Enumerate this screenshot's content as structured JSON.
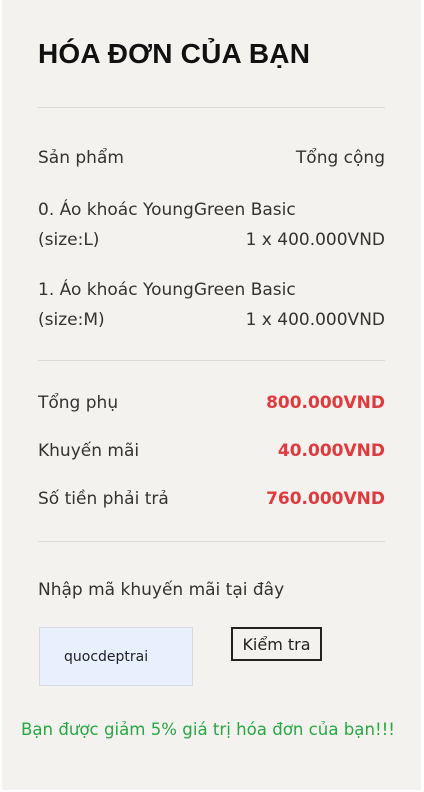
{
  "invoice": {
    "title": "HÓA ĐƠN CỦA BẠN",
    "header": {
      "product_label": "Sản phẩm",
      "total_label": "Tổng cộng"
    },
    "items": [
      {
        "name": "0. Áo khoác YoungGreen Basic",
        "size": "(size:L)",
        "qty_price": "1 x 400.000VND"
      },
      {
        "name": "1. Áo khoác YoungGreen Basic",
        "size": "(size:M)",
        "qty_price": "1 x 400.000VND"
      }
    ],
    "summary": {
      "subtotal_label": "Tổng phụ",
      "subtotal_value": "800.000VND",
      "discount_label": "Khuyến mãi",
      "discount_value": "40.000VND",
      "payable_label": "Số tiền phải trả",
      "payable_value": "760.000VND"
    },
    "coupon": {
      "prompt": "Nhập mã khuyến mãi tại đây",
      "value": "quocdeptrai",
      "button_label": "Kiểm tra",
      "message": "Bạn được giảm 5% giá trị hóa đơn của bạn!!!"
    }
  },
  "colors": {
    "panel_background": "#f3f2ee",
    "price": "#e03a3e",
    "success": "#28a745",
    "input_background": "#e8f0fe"
  }
}
